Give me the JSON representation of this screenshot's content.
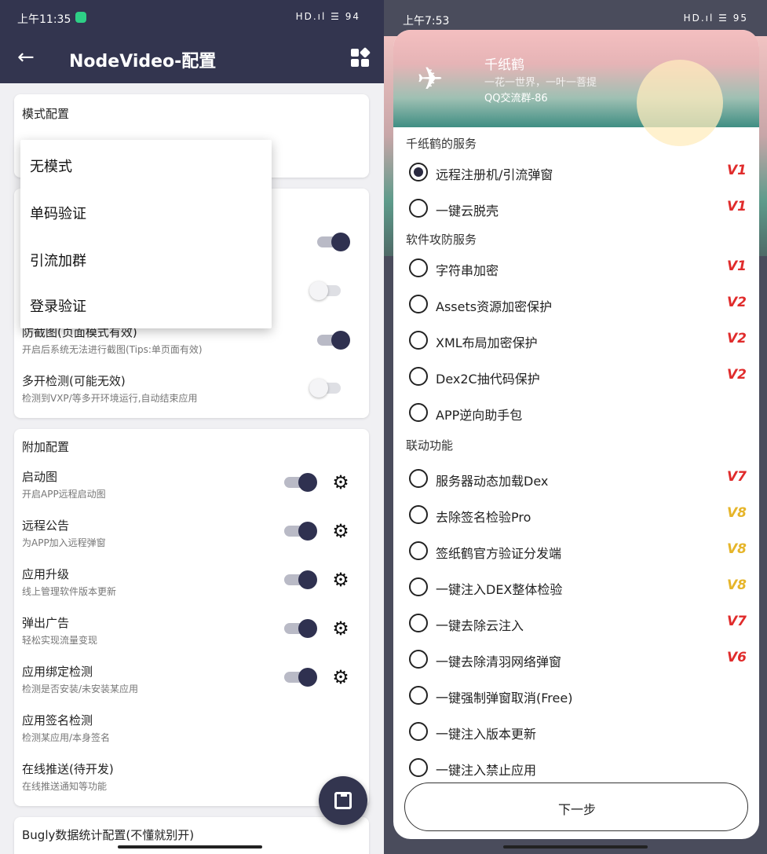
{
  "left": {
    "status": {
      "time": "上午11:35",
      "indicators": "HD.ıl ☰ 94"
    },
    "appbar": {
      "back_icon": "←",
      "title": "NodeVideo-配置",
      "grid_icon": "dashboard-icon"
    },
    "mode_card": {
      "title": "模式配置"
    },
    "dropdown": {
      "items": [
        "无模式",
        "单码验证",
        "引流加群",
        "登录验证"
      ]
    },
    "security": {
      "rows": [
        {
          "title": "防截图(页面模式有效)",
          "subtitle": "开启后系统无法进行截图(Tips:单页面有效)",
          "on": true
        },
        {
          "title": "多开检测(可能无效)",
          "subtitle": "检测到VXP/等多开环境运行,自动结束应用",
          "on": false
        }
      ]
    },
    "extra": {
      "title": "附加配置",
      "rows": [
        {
          "title": "启动图",
          "subtitle": "开启APP远程启动图",
          "on": true
        },
        {
          "title": "远程公告",
          "subtitle": "为APP加入远程弹窗",
          "on": true
        },
        {
          "title": "应用升级",
          "subtitle": "线上管理软件版本更新",
          "on": true
        },
        {
          "title": "弹出广告",
          "subtitle": "轻松实现流量变现",
          "on": true
        },
        {
          "title": "应用绑定检测",
          "subtitle": "检测是否安装/未安装某应用",
          "on": true
        },
        {
          "title": "应用签名检测",
          "subtitle": "检测某应用/本身签名"
        },
        {
          "title": "在线推送(待开发)",
          "subtitle": "在线推送通知等功能"
        }
      ]
    },
    "bugly": {
      "title": "Bugly数据统计配置(不懂就别开)"
    }
  },
  "right": {
    "status": {
      "time": "上午7:53",
      "indicators": "HD.ıl ☰ 95"
    },
    "banner": {
      "title": "千纸鹤",
      "line1": "一花一世界，一叶一菩提",
      "line2": "QQ交流群-86"
    },
    "sections": [
      {
        "title": "千纸鹤的服务",
        "options": [
          {
            "label": "远程注册机/引流弹窗",
            "badge": "V1",
            "color": "#e02b2b",
            "selected": true
          },
          {
            "label": "一键云脱壳",
            "badge": "V1",
            "color": "#e02b2b",
            "selected": false
          }
        ]
      },
      {
        "title": "软件攻防服务",
        "options": [
          {
            "label": "字符串加密",
            "badge": "V1",
            "color": "#e02b2b"
          },
          {
            "label": "Assets资源加密保护",
            "badge": "V2",
            "color": "#e02b2b"
          },
          {
            "label": "XML布局加密保护",
            "badge": "V2",
            "color": "#e02b2b"
          },
          {
            "label": "Dex2C抽代码保护",
            "badge": "V2",
            "color": "#e02b2b"
          },
          {
            "label": "APP逆向助手包",
            "badge": "",
            "color": "#e02b2b"
          }
        ]
      },
      {
        "title": "联动功能",
        "options": [
          {
            "label": "服务器动态加载Dex",
            "badge": "V7",
            "color": "#e02b2b"
          },
          {
            "label": "去除签名检验Pro",
            "badge": "V8",
            "color": "#e6b52a"
          },
          {
            "label": "签纸鹤官方验证分发端",
            "badge": "V8",
            "color": "#e6b52a"
          },
          {
            "label": "一键注入DEX整体检验",
            "badge": "V8",
            "color": "#e6b52a"
          },
          {
            "label": "一键去除云注入",
            "badge": "V7",
            "color": "#e02b2b"
          },
          {
            "label": "一键去除清羽网络弹窗",
            "badge": "V6",
            "color": "#e02b2b"
          },
          {
            "label": "一键强制弹窗取消(Free)",
            "badge": "",
            "color": "#e02b2b"
          },
          {
            "label": "一键注入版本更新",
            "badge": "",
            "color": "#e02b2b"
          },
          {
            "label": "一键注入禁止应用",
            "badge": "",
            "color": "#e02b2b"
          }
        ]
      }
    ],
    "next_label": "下一步"
  }
}
